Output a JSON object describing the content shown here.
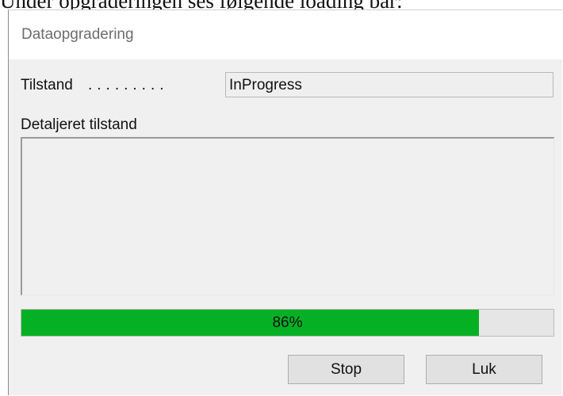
{
  "document": {
    "caption": "Under opgraderingen ses følgende loading bar:"
  },
  "window": {
    "title": "Dataopgradering"
  },
  "state": {
    "label": "Tilstand",
    "dots": ".........",
    "value": "InProgress"
  },
  "details": {
    "label": "Detaljeret tilstand",
    "text": ""
  },
  "progress": {
    "value": 0.86,
    "label": "86%",
    "fill_color": "#06b025"
  },
  "buttons": {
    "stop": "Stop",
    "close": "Luk"
  }
}
